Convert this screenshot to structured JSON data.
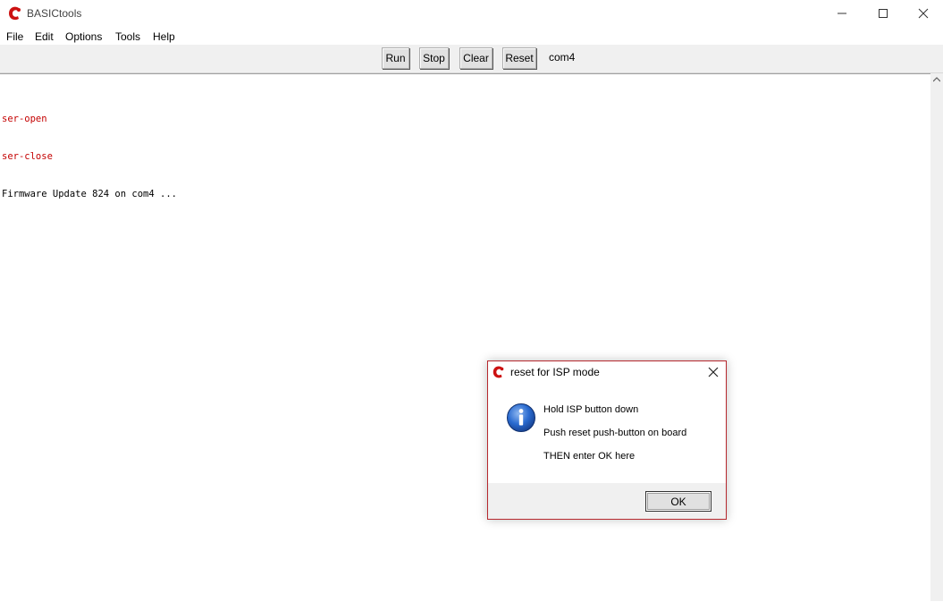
{
  "window": {
    "title": "BASICtools",
    "icon": "basictools-app-icon",
    "minimize_icon": "minimize-icon",
    "maximize_icon": "maximize-icon",
    "close_icon": "close-icon"
  },
  "menu": {
    "items": [
      "File",
      "Edit",
      "Options",
      "Tools",
      "Help"
    ]
  },
  "toolbar": {
    "buttons": [
      "Run",
      "Stop",
      "Clear",
      "Reset"
    ],
    "port": "com4"
  },
  "console": {
    "lines": [
      {
        "text": "ser-open",
        "color": "#c40000"
      },
      {
        "text": "ser-close",
        "color": "#c40000"
      },
      {
        "text": "Firmware Update 824 on com4 ...",
        "color": "#000000"
      }
    ]
  },
  "dialog": {
    "title": "reset for ISP mode",
    "icon": "info-icon",
    "messages": [
      "Hold ISP button down",
      "Push reset push-button on board",
      "THEN enter OK here"
    ],
    "ok_label": "OK"
  },
  "colors": {
    "error_text": "#c40000",
    "dialog_border": "#b6282e",
    "toolbar_bg": "#f0f0f0"
  }
}
